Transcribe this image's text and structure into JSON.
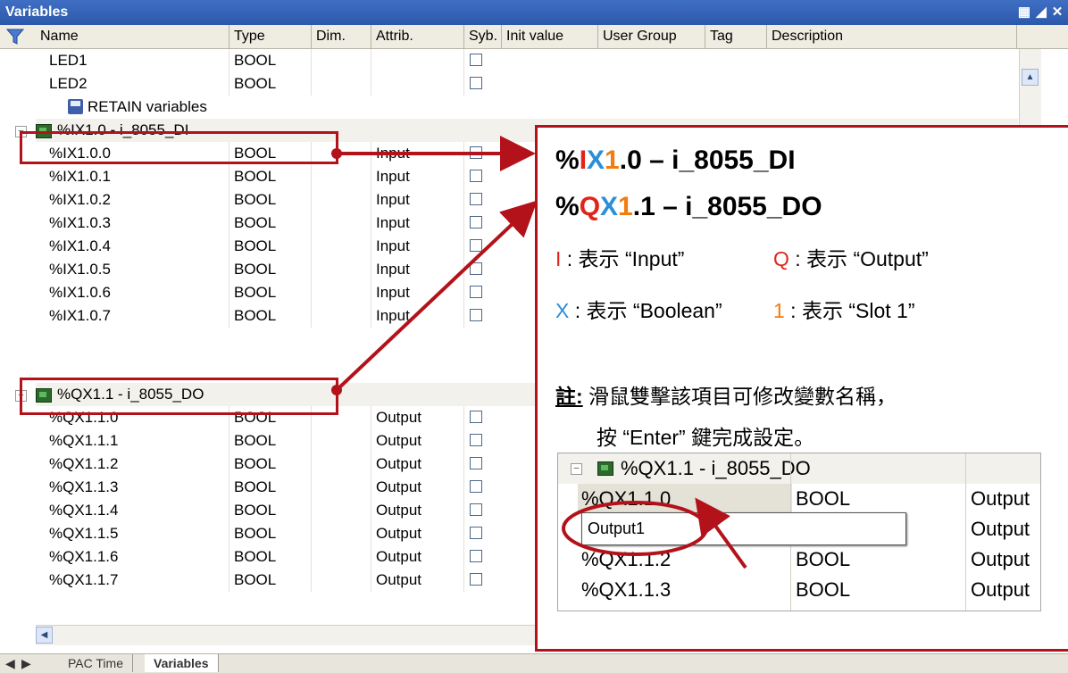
{
  "window": {
    "title": "Variables"
  },
  "columns": [
    "Name",
    "Type",
    "Dim.",
    "Attrib.",
    "Syb.",
    "Init value",
    "User Group",
    "Tag",
    "Description"
  ],
  "rows": [
    {
      "name": "LED1",
      "type": "BOOL",
      "attrib": ""
    },
    {
      "name": "LED2",
      "type": "BOOL",
      "attrib": ""
    }
  ],
  "retain_label": "RETAIN variables",
  "groups": [
    {
      "label": "%IX1.0 - i_8055_DI",
      "rows": [
        {
          "name": "%IX1.0.0",
          "type": "BOOL",
          "attrib": "Input"
        },
        {
          "name": "%IX1.0.1",
          "type": "BOOL",
          "attrib": "Input"
        },
        {
          "name": "%IX1.0.2",
          "type": "BOOL",
          "attrib": "Input"
        },
        {
          "name": "%IX1.0.3",
          "type": "BOOL",
          "attrib": "Input"
        },
        {
          "name": "%IX1.0.4",
          "type": "BOOL",
          "attrib": "Input"
        },
        {
          "name": "%IX1.0.5",
          "type": "BOOL",
          "attrib": "Input"
        },
        {
          "name": "%IX1.0.6",
          "type": "BOOL",
          "attrib": "Input"
        },
        {
          "name": "%IX1.0.7",
          "type": "BOOL",
          "attrib": "Input"
        }
      ]
    },
    {
      "label": "%QX1.1 - i_8055_DO",
      "rows": [
        {
          "name": "%QX1.1.0",
          "type": "BOOL",
          "attrib": "Output"
        },
        {
          "name": "%QX1.1.1",
          "type": "BOOL",
          "attrib": "Output"
        },
        {
          "name": "%QX1.1.2",
          "type": "BOOL",
          "attrib": "Output"
        },
        {
          "name": "%QX1.1.3",
          "type": "BOOL",
          "attrib": "Output"
        },
        {
          "name": "%QX1.1.4",
          "type": "BOOL",
          "attrib": "Output"
        },
        {
          "name": "%QX1.1.5",
          "type": "BOOL",
          "attrib": "Output"
        },
        {
          "name": "%QX1.1.6",
          "type": "BOOL",
          "attrib": "Output"
        },
        {
          "name": "%QX1.1.7",
          "type": "BOOL",
          "attrib": "Output"
        }
      ]
    }
  ],
  "tabs": [
    "PAC Time",
    "Variables"
  ],
  "callout": {
    "line1": {
      "p1": "%",
      "p2": "I",
      "p3": "X",
      "p4": "1",
      "p5": ".0 – i_8055_DI"
    },
    "line2": {
      "p1": "%",
      "p2": "Q",
      "p3": "X",
      "p4": "1",
      "p5": ".1 – i_8055_DO"
    },
    "legend_i": {
      "key": "I",
      "text": " : 表示 “Input”"
    },
    "legend_q": {
      "key": "Q",
      "text": " : 表示 “Output”"
    },
    "legend_x": {
      "key": "X",
      "text": " : 表示 “Boolean”"
    },
    "legend_1": {
      "key": "1",
      "text": " : 表示 “Slot 1”"
    },
    "note_label": "註:",
    "note_line1": " 滑鼠雙擊該項目可修改變數名稱，",
    "note_line2": "按 “Enter” 鍵完成設定。"
  },
  "inset": {
    "group_label": "%QX1.1 - i_8055_DO",
    "rows": [
      {
        "name": "%QX1.1.0",
        "type": "BOOL",
        "attrib": "Output"
      },
      {
        "name": "",
        "type": "",
        "attrib": "Output"
      },
      {
        "name": "%QX1.1.2",
        "type": "BOOL",
        "attrib": "Output"
      },
      {
        "name": "%QX1.1.3",
        "type": "BOOL",
        "attrib": "Output"
      }
    ],
    "edit_value": "Output1"
  },
  "colors": {
    "annotation": "#b3121a",
    "red": "#e0241b",
    "blue": "#2a8ed8",
    "orange": "#f07c12",
    "titlebar": "#3a66b8"
  }
}
